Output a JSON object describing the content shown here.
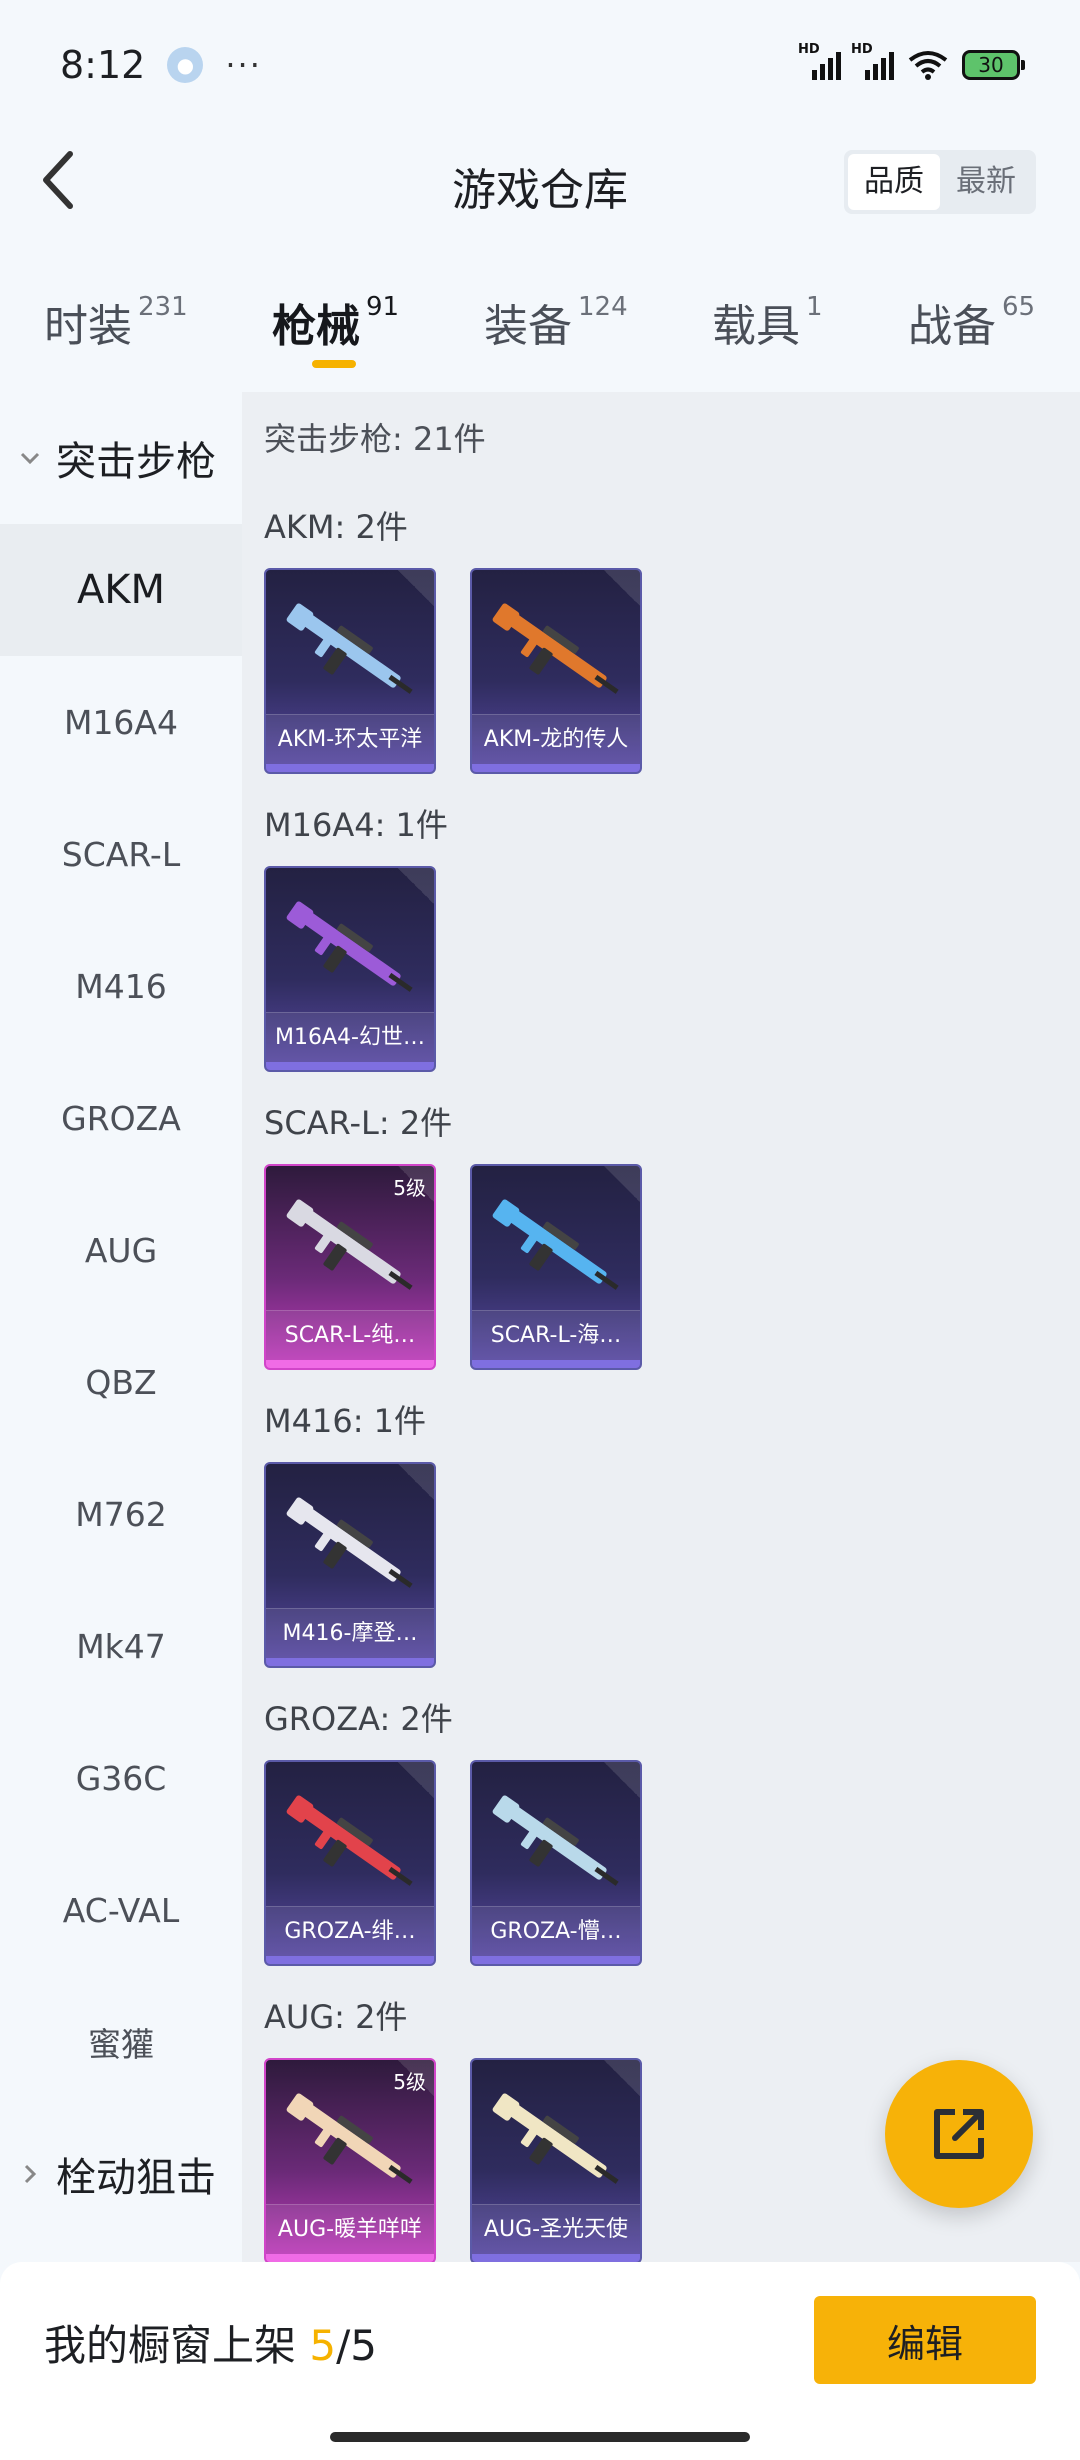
{
  "status_bar": {
    "time": "8:12",
    "more": "···",
    "signal1_hd": "HD",
    "signal2_hd": "HD",
    "battery": "30"
  },
  "header": {
    "title": "游戏仓库",
    "sort_options": [
      "品质",
      "最新"
    ],
    "sort_active": "品质"
  },
  "tabs": [
    {
      "label": "时装",
      "count": "231"
    },
    {
      "label": "枪械",
      "count": "91"
    },
    {
      "label": "装备",
      "count": "124"
    },
    {
      "label": "载具",
      "count": "1"
    },
    {
      "label": "战备",
      "count": "65"
    }
  ],
  "active_tab": "枪械",
  "sidebar": {
    "group_expanded": "突击步枪",
    "items": [
      "AKM",
      "M16A4",
      "SCAR-L",
      "M416",
      "GROZA",
      "AUG",
      "QBZ",
      "M762",
      "Mk47",
      "G36C",
      "AC-VAL",
      "蜜獾"
    ],
    "active_item": "AKM",
    "group_collapsed": "栓动狙击"
  },
  "content": {
    "heading": "突击步枪: 21件",
    "groups": [
      {
        "title": "AKM: 2件",
        "items": [
          {
            "name": "AKM-环太平洋",
            "quality": "purple",
            "gun_color": "#9bc6ee"
          },
          {
            "name": "AKM-龙的传人",
            "quality": "purple",
            "gun_color": "#e0782c"
          }
        ]
      },
      {
        "title": "M16A4: 1件",
        "items": [
          {
            "name": "M16A4-幻世…",
            "quality": "purple",
            "gun_color": "#9c5bd8"
          }
        ]
      },
      {
        "title": "SCAR-L: 2件",
        "items": [
          {
            "name": "SCAR-L-纯…",
            "quality": "pink",
            "level": "5级",
            "gun_color": "#d9d9e2"
          },
          {
            "name": "SCAR-L-海…",
            "quality": "purple",
            "gun_color": "#56b4f0"
          }
        ]
      },
      {
        "title": "M416: 1件",
        "items": [
          {
            "name": "M416-摩登…",
            "quality": "purple",
            "gun_color": "#e6e6ee"
          }
        ]
      },
      {
        "title": "GROZA: 2件",
        "items": [
          {
            "name": "GROZA-绯…",
            "quality": "purple",
            "gun_color": "#e2434b"
          },
          {
            "name": "GROZA-懵…",
            "quality": "purple",
            "gun_color": "#b9d9ea"
          }
        ]
      },
      {
        "title": "AUG: 2件",
        "items": [
          {
            "name": "AUG-暖羊咩咩",
            "quality": "pink",
            "level": "5级",
            "gun_color": "#f1d6b7"
          },
          {
            "name": "AUG-圣光天使",
            "quality": "purple",
            "gun_color": "#f0e6c4"
          }
        ]
      }
    ]
  },
  "bottom": {
    "showcase_label": "我的橱窗上架",
    "showcase_current": "5",
    "showcase_sep_total": "/5",
    "edit_label": "编辑"
  },
  "colors": {
    "accent": "#f7b208",
    "purple_quality": "#5a4aa6",
    "pink_quality": "#c23cbd"
  }
}
